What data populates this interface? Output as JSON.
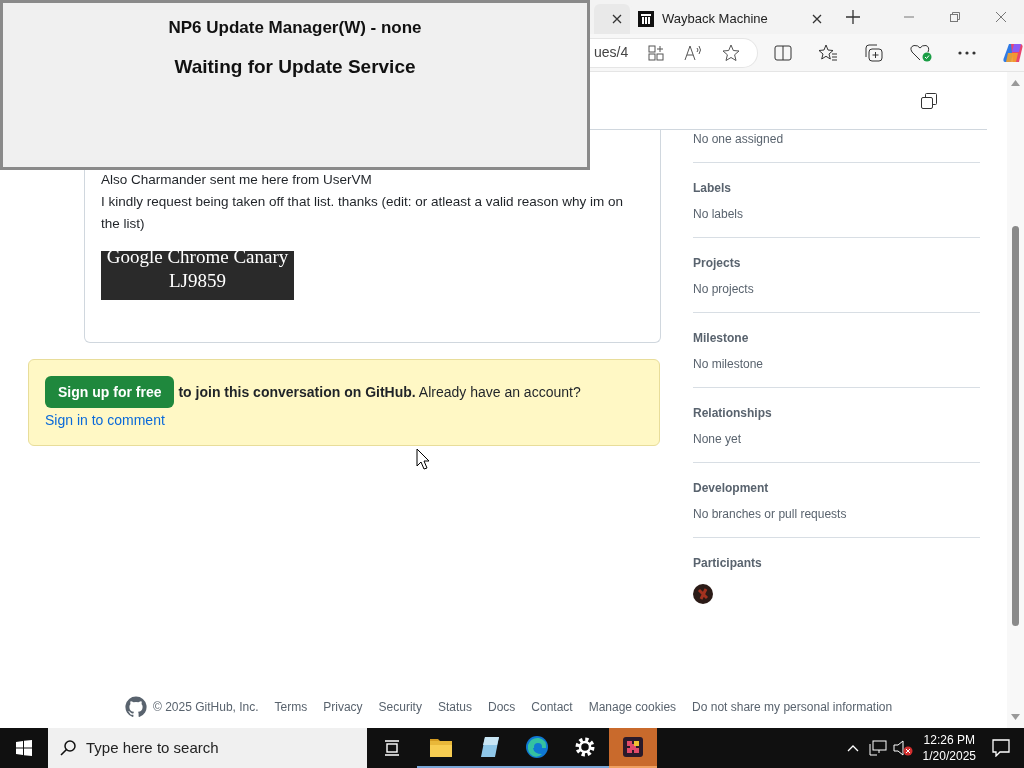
{
  "overlay_window": {
    "title": "NP6 Update Manager(W) - none",
    "message": "Waiting for Update Service"
  },
  "browser": {
    "tabs": [
      {
        "selected": false
      },
      {
        "title": "Wayback Machine",
        "selected": true
      }
    ],
    "address": "ues/4"
  },
  "comment": {
    "lines": [
      "Also Charmander sent me here from UserVM",
      "I kindly request being taken off that list. thanks (edit: or atleast a valid reason why im on the list)"
    ],
    "attachment_lines": [
      "Google Chrome Canary",
      "LJ9859"
    ]
  },
  "signup_banner": {
    "button": "Sign up for free",
    "text": "to join this conversation on GitHub.",
    "question": "Already have an account?",
    "link": "Sign in to comment"
  },
  "sidebar": {
    "sections": [
      {
        "value": "No one assigned"
      },
      {
        "heading": "Labels",
        "value": "No labels"
      },
      {
        "heading": "Projects",
        "value": "No projects"
      },
      {
        "heading": "Milestone",
        "value": "No milestone"
      },
      {
        "heading": "Relationships",
        "value": "None yet"
      },
      {
        "heading": "Development",
        "value": "No branches or pull requests"
      },
      {
        "heading": "Participants",
        "kind": "avatars"
      }
    ]
  },
  "footer": {
    "copyright": "© 2025 GitHub, Inc.",
    "links": [
      "Terms",
      "Privacy",
      "Security",
      "Status",
      "Docs",
      "Contact",
      "Manage cookies",
      "Do not share my personal information"
    ]
  },
  "taskbar": {
    "search_placeholder": "Type here to search",
    "apps": [
      {
        "kind": "files",
        "selected": false
      },
      {
        "kind": "notepad",
        "selected": false
      },
      {
        "kind": "edge",
        "selected": false
      },
      {
        "kind": "settings",
        "selected": false
      },
      {
        "kind": "puzzle",
        "selected": true
      }
    ],
    "time": "12:26 PM",
    "date": "1/20/2025"
  }
}
